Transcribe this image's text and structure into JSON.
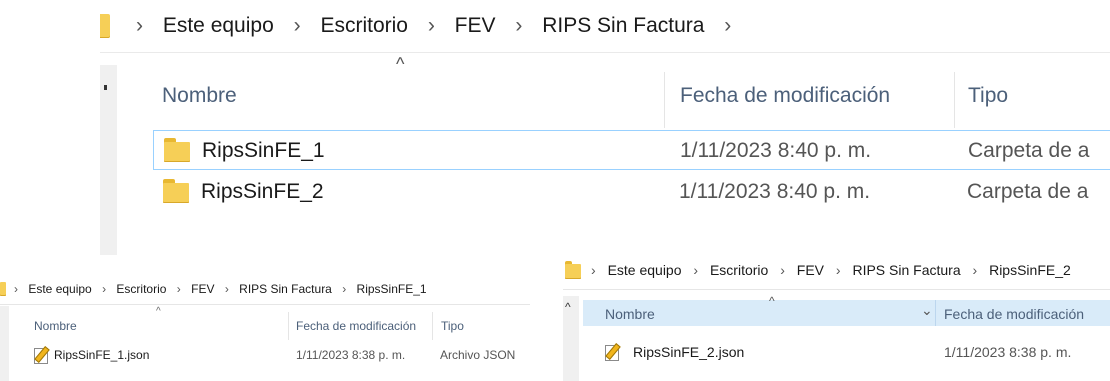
{
  "top": {
    "breadcrumb": [
      "Este equipo",
      "Escritorio",
      "FEV",
      "RIPS Sin Factura"
    ],
    "separator": "›",
    "columns": {
      "name": "Nombre",
      "date": "Fecha de modificación",
      "type": "Tipo"
    },
    "rows": [
      {
        "name": "RipsSinFE_1",
        "date": "1/11/2023 8:40 p. m.",
        "type": "Carpeta de a"
      },
      {
        "name": "RipsSinFE_2",
        "date": "1/11/2023 8:40 p. m.",
        "type": "Carpeta de a"
      }
    ]
  },
  "bottom_left": {
    "breadcrumb": [
      "Este equipo",
      "Escritorio",
      "FEV",
      "RIPS Sin Factura",
      "RipsSinFE_1"
    ],
    "separator": "›",
    "columns": {
      "name": "Nombre",
      "date": "Fecha de modificación",
      "type": "Tipo"
    },
    "rows": [
      {
        "name": "RipsSinFE_1.json",
        "date": "1/11/2023 8:38 p. m.",
        "type": "Archivo JSON"
      }
    ]
  },
  "bottom_right": {
    "breadcrumb": [
      "Este equipo",
      "Escritorio",
      "FEV",
      "RIPS Sin Factura",
      "RipsSinFE_2"
    ],
    "separator": "›",
    "columns": {
      "name": "Nombre",
      "date": "Fecha de modificación"
    },
    "rows": [
      {
        "name": "RipsSinFE_2.json",
        "date": "1/11/2023 8:38 p. m."
      }
    ]
  },
  "icons": {
    "folder_color": "#f6cf57",
    "selected_row_border": "#99d1ff",
    "sort_up": "^",
    "expand_chevron": "⌄"
  }
}
